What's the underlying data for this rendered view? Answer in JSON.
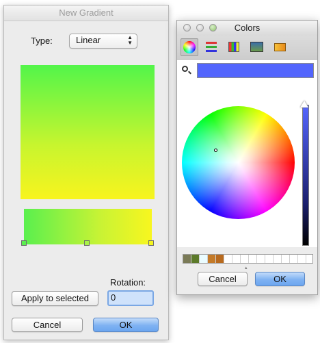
{
  "gradient_window": {
    "title": "New Gradient",
    "type_label": "Type:",
    "type_value": "Linear",
    "rotation_label": "Rotation:",
    "rotation_value": "0",
    "apply_button": "Apply to selected",
    "cancel_button": "Cancel",
    "ok_button": "OK",
    "colors": {
      "start": "#52f54a",
      "end": "#f8f41e"
    },
    "stops": [
      {
        "position": 0,
        "color": "#5aef4f"
      },
      {
        "position": 0.5,
        "color": "#a8f24a"
      },
      {
        "position": 1,
        "color": "#f4f51e"
      }
    ]
  },
  "colors_window": {
    "title": "Colors",
    "toolbar_icons": [
      "color-wheel-icon",
      "color-sliders-icon",
      "color-palettes-icon",
      "image-palettes-icon",
      "crayons-icon"
    ],
    "current_color": "#5265fd",
    "brightness": 0.97,
    "favorites": [
      "#7a7a56",
      "#5c7a2a",
      "#eafcff",
      "#c47a28",
      "#b86a1e",
      "#ffffff",
      "#ffffff",
      "#ffffff",
      "#ffffff",
      "#ffffff",
      "#ffffff",
      "#ffffff",
      "#ffffff",
      "#ffffff",
      "#ffffff"
    ],
    "cancel_button": "Cancel",
    "ok_button": "OK"
  }
}
